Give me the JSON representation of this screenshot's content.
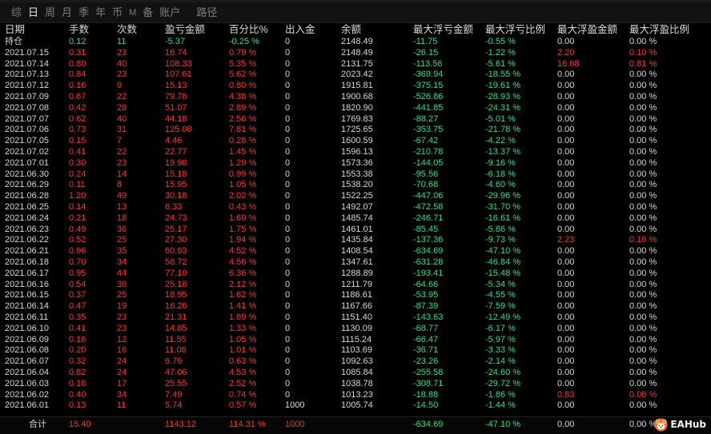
{
  "tabs": [
    "综",
    "日",
    "周",
    "月",
    "季",
    "年",
    "币",
    "M",
    "备",
    "账户",
    "路径"
  ],
  "columns": [
    "日期",
    "手数",
    "次数",
    "盈亏金额",
    "百分比%",
    "出入金",
    "余额",
    "最大浮亏金额",
    "最大浮亏比例",
    "最大浮盈金额",
    "最大浮盈比例"
  ],
  "rows": [
    [
      "持仓",
      "0.12",
      "11",
      "-5.37",
      "-0.25 %",
      "0",
      "2148.49",
      "-11.75",
      "-0.55 %",
      "0.00",
      "0.00 %"
    ],
    [
      "2021.07.15",
      "0.31",
      "23",
      "16.74",
      "0.79 %",
      "0",
      "2148.49",
      "-26.15",
      "-1.22 %",
      "2.20",
      "0.10 %"
    ],
    [
      "2021.07.14",
      "0.80",
      "40",
      "108.33",
      "5.35 %",
      "0",
      "2131.75",
      "-113.56",
      "-5.61 %",
      "16.68",
      "0.81 %"
    ],
    [
      "2021.07.13",
      "0.84",
      "23",
      "107.61",
      "5.62 %",
      "0",
      "2023.42",
      "-369.94",
      "-18.55 %",
      "0.00",
      "0.00 %"
    ],
    [
      "2021.07.12",
      "0.16",
      "9",
      "15.13",
      "0.80 %",
      "0",
      "1915.81",
      "-375.15",
      "-19.61 %",
      "0.00",
      "0.00 %"
    ],
    [
      "2021.07.09",
      "0.67",
      "22",
      "79.78",
      "4.38 %",
      "0",
      "1900.68",
      "-526.86",
      "-28.93 %",
      "0.00",
      "0.00 %"
    ],
    [
      "2021.07.08",
      "0.42",
      "28",
      "51.07",
      "2.89 %",
      "0",
      "1820.90",
      "-441.85",
      "-24.31 %",
      "0.00",
      "0.00 %"
    ],
    [
      "2021.07.07",
      "0.62",
      "40",
      "44.18",
      "2.56 %",
      "0",
      "1769.83",
      "-88.27",
      "-5.01 %",
      "0.00",
      "0.00 %"
    ],
    [
      "2021.07.06",
      "0.73",
      "31",
      "125.08",
      "7.81 %",
      "0",
      "1725.65",
      "-353.75",
      "-21.78 %",
      "0.00",
      "0.00 %"
    ],
    [
      "2021.07.05",
      "0.15",
      "7",
      "4.46",
      "0.28 %",
      "0",
      "1600.59",
      "-67.42",
      "-4.22 %",
      "0.00",
      "0.00 %"
    ],
    [
      "2021.07.02",
      "0.41",
      "22",
      "22.77",
      "1.45 %",
      "0",
      "1596.13",
      "-210.78",
      "-13.37 %",
      "0.00",
      "0.00 %"
    ],
    [
      "2021.07.01",
      "0.30",
      "23",
      "19.98",
      "1.29 %",
      "0",
      "1573.36",
      "-144.05",
      "-9.16 %",
      "0.00",
      "0.00 %"
    ],
    [
      "2021.06.30",
      "0.24",
      "14",
      "15.18",
      "0.99 %",
      "0",
      "1553.38",
      "-95.56",
      "-6.18 %",
      "0.00",
      "0.00 %"
    ],
    [
      "2021.06.29",
      "0.11",
      "8",
      "15.95",
      "1.05 %",
      "0",
      "1538.20",
      "-70.68",
      "-4.60 %",
      "0.00",
      "0.00 %"
    ],
    [
      "2021.06.28",
      "1.20",
      "49",
      "30.18",
      "2.02 %",
      "0",
      "1522.25",
      "-447.06",
      "-29.96 %",
      "0.00",
      "0.00 %"
    ],
    [
      "2021.06.25",
      "0.14",
      "13",
      "6.33",
      "0.43 %",
      "0",
      "1492.07",
      "-472.58",
      "-31.70 %",
      "0.00",
      "0.00 %"
    ],
    [
      "2021.06.24",
      "0.21",
      "18",
      "24.73",
      "1.69 %",
      "0",
      "1485.74",
      "-246.71",
      "-16.61 %",
      "0.00",
      "0.00 %"
    ],
    [
      "2021.06.23",
      "0.49",
      "36",
      "25.17",
      "1.75 %",
      "0",
      "1461.01",
      "-85.45",
      "-5.86 %",
      "0.00",
      "0.00 %"
    ],
    [
      "2021.06.22",
      "0.52",
      "25",
      "27.30",
      "1.94 %",
      "0",
      "1435.84",
      "-137.36",
      "-9.73 %",
      "2.23",
      "0.16 %"
    ],
    [
      "2021.06.21",
      "0.96",
      "35",
      "60.93",
      "4.52 %",
      "0",
      "1408.54",
      "-634.69",
      "-47.10 %",
      "0.00",
      "0.00 %"
    ],
    [
      "2021.06.18",
      "0.70",
      "34",
      "58.72",
      "4.56 %",
      "0",
      "1347.61",
      "-631.28",
      "-46.84 %",
      "0.00",
      "0.00 %"
    ],
    [
      "2021.06.17",
      "0.95",
      "44",
      "77.10",
      "6.36 %",
      "0",
      "1288.89",
      "-193.41",
      "-15.48 %",
      "0.00",
      "0.00 %"
    ],
    [
      "2021.06.16",
      "0.54",
      "38",
      "25.18",
      "2.12 %",
      "0",
      "1211.79",
      "-64.66",
      "-5.34 %",
      "0.00",
      "0.00 %"
    ],
    [
      "2021.06.15",
      "0.37",
      "25",
      "18.95",
      "1.62 %",
      "0",
      "1186.61",
      "-53.95",
      "-4.55 %",
      "0.00",
      "0.00 %"
    ],
    [
      "2021.06.14",
      "0.47",
      "19",
      "16.26",
      "1.41 %",
      "0",
      "1167.66",
      "-87.39",
      "-7.59 %",
      "0.00",
      "0.00 %"
    ],
    [
      "2021.06.11",
      "0.35",
      "23",
      "21.31",
      "1.89 %",
      "0",
      "1151.40",
      "-143.63",
      "-12.49 %",
      "0.00",
      "0.00 %"
    ],
    [
      "2021.06.10",
      "0.41",
      "23",
      "14.85",
      "1.33 %",
      "0",
      "1130.09",
      "-68.77",
      "-6.17 %",
      "0.00",
      "0.00 %"
    ],
    [
      "2021.06.09",
      "0.16",
      "12",
      "11.55",
      "1.05 %",
      "0",
      "1115.24",
      "-66.47",
      "-5.97 %",
      "0.00",
      "0.00 %"
    ],
    [
      "2021.06.08",
      "0.20",
      "16",
      "11.06",
      "1.01 %",
      "0",
      "1103.69",
      "-36.71",
      "-3.33 %",
      "0.00",
      "0.00 %"
    ],
    [
      "2021.06.07",
      "0.32",
      "24",
      "6.79",
      "0.63 %",
      "0",
      "1092.63",
      "-23.26",
      "-2.14 %",
      "0.00",
      "0.00 %"
    ],
    [
      "2021.06.04",
      "0.82",
      "24",
      "47.06",
      "4.53 %",
      "0",
      "1085.84",
      "-255.58",
      "-24.60 %",
      "0.00",
      "0.00 %"
    ],
    [
      "2021.06.03",
      "0.18",
      "17",
      "25.55",
      "2.52 %",
      "0",
      "1038.78",
      "-308.71",
      "-29.72 %",
      "0.00",
      "0.00 %"
    ],
    [
      "2021.06.02",
      "0.40",
      "34",
      "7.49",
      "0.74 %",
      "0",
      "1013.23",
      "-18.88",
      "-1.86 %",
      "0.83",
      "0.08 %"
    ],
    [
      "2021.06.01",
      "0.13",
      "11",
      "5.74",
      "0.57 %",
      "1000",
      "1005.74",
      "-14.50",
      "-1.44 %",
      "0.00",
      "0.00 %"
    ]
  ],
  "footer": [
    "合计",
    "15.40",
    "",
    "1143.12",
    "114.31 %",
    "1000",
    "",
    "-634.69",
    "-47.10 %",
    "0.00",
    "0.00 %"
  ],
  "logo_text": "EAHub",
  "colors": {
    "positive": "#ff3030",
    "negative": "#22e08a",
    "neutral": "#d9d9d9"
  }
}
